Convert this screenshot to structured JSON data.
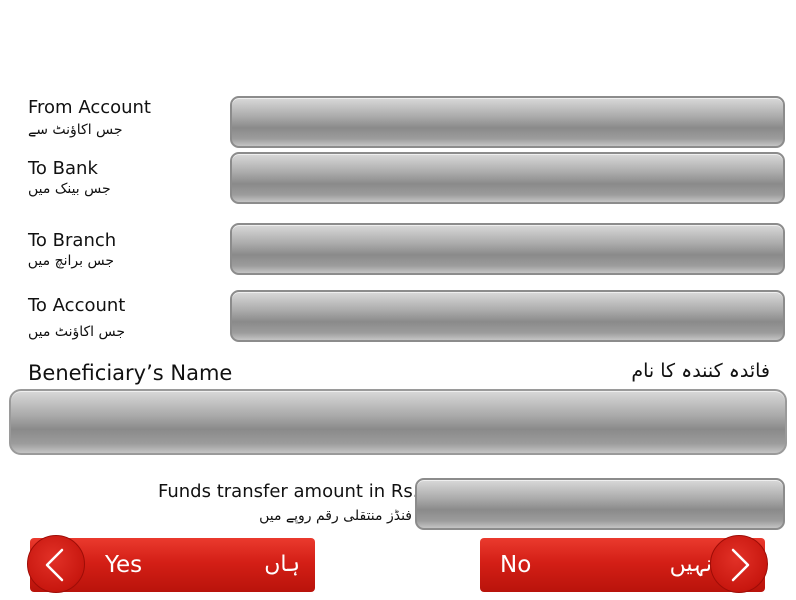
{
  "form": {
    "from_account": {
      "label_en": "From Account",
      "label_ur": "جس اکاؤنٹ سے"
    },
    "to_bank": {
      "label_en": "To Bank",
      "label_ur": "جس بینک میں"
    },
    "to_branch": {
      "label_en": "To Branch",
      "label_ur": "جس برانچ میں"
    },
    "to_account": {
      "label_en": "To Account",
      "label_ur": "جس اکاؤنٹ میں"
    },
    "beneficiary_name": {
      "label_en": "Beneficiary’s Name",
      "label_ur": "فائدہ کنندہ کا نام"
    },
    "amount": {
      "label_en": "Funds transfer amount in Rs.",
      "label_ur": "فنڈز منتقلی رقم روپے میں"
    }
  },
  "buttons": {
    "yes": {
      "label_en": "Yes",
      "label_ur": "ہاں"
    },
    "no": {
      "label_en": "No",
      "label_ur": "نہیں"
    }
  },
  "colors": {
    "button_red": "#d41f16",
    "field_gray": "#a9a9a9"
  },
  "icons": {
    "yes_icon": "chevron-left-icon",
    "no_icon": "chevron-right-icon"
  }
}
